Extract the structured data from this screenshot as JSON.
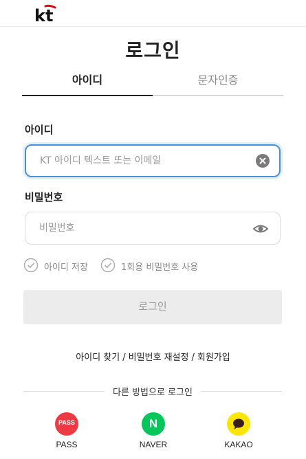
{
  "header": {
    "logo_text": "kt"
  },
  "page": {
    "title": "로그인"
  },
  "tabs": [
    {
      "label": "아이디",
      "active": true
    },
    {
      "label": "문자인증",
      "active": false
    }
  ],
  "form": {
    "id_label": "아이디",
    "id_placeholder": "KT 아이디 텍스트 또는 이메일",
    "id_value": "",
    "password_label": "비밀번호",
    "password_placeholder": "비밀번호",
    "password_value": ""
  },
  "options": {
    "save_id": "아이디 저장",
    "one_time_password": "1회용 비밀번호 사용"
  },
  "login_button": "로그인",
  "links": {
    "find_id": "아이디 찾기",
    "reset_password": "비밀번호 재설정",
    "sign_up": "회원가입",
    "separator": "/"
  },
  "alt_login": {
    "divider_text": "다른 방법으로 로그인",
    "providers": [
      {
        "label": "PASS",
        "icon": "pass-icon",
        "icon_text": "PASS",
        "color": "#ee3a43"
      },
      {
        "label": "NAVER",
        "icon": "naver-icon",
        "icon_text": "N",
        "color": "#03c75a"
      },
      {
        "label": "KAKAO",
        "icon": "kakao-icon",
        "icon_text": "",
        "color": "#fee500"
      }
    ]
  },
  "colors": {
    "focus_border": "#4a90d9",
    "brand_red": "#e60012",
    "disabled_button": "#ececec"
  }
}
